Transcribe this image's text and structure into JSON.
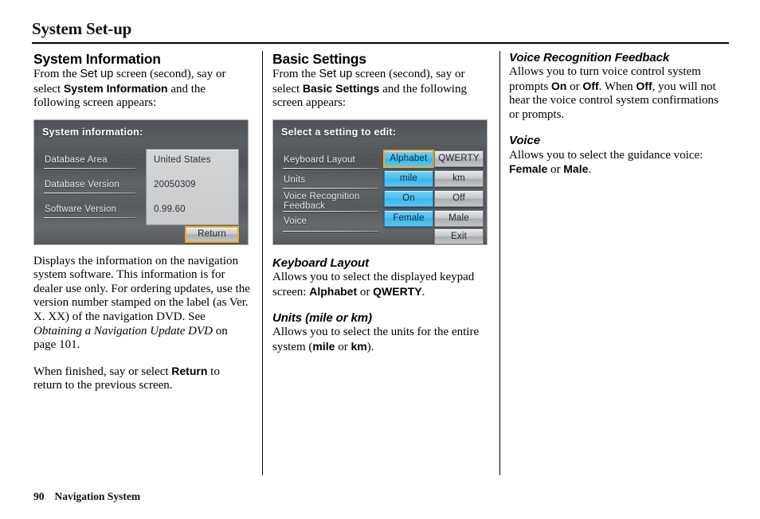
{
  "page": {
    "title": "System Set-up",
    "footer_page_number": "90",
    "footer_label": "Navigation System"
  },
  "columns": {
    "left": {
      "heading": "System Information",
      "intro_part1": "From the ",
      "intro_sans": "Set up",
      "intro_part2": " screen (second), say or select ",
      "intro_bold": "System Information",
      "intro_part3": " and the following screen appears:",
      "body_1_a": "Displays the information on the navigation system software. This information is for dealer use only. For ordering updates, use the version number stamped on the label (as Ver. X. XX) of the navigation DVD. See ",
      "body_1_italic": "Obtaining a Navigation Update DVD",
      "body_1_b": " on page 101.",
      "body_2_a": "When finished, say or select ",
      "body_2_bold": "Return",
      "body_2_b": " to return to the previous screen."
    },
    "middle": {
      "heading": "Basic Settings",
      "intro_part1": "From the ",
      "intro_sans": "Set up",
      "intro_part2": " screen (second), say or select ",
      "intro_bold": "Basic Settings",
      "intro_part3": " and the following screen appears:",
      "sub1_heading": "Keyboard Layout",
      "sub1_a": "Allows you to select the displayed keypad screen: ",
      "sub1_bold1": "Alphabet",
      "sub1_b": " or ",
      "sub1_bold2": "QWERTY",
      "sub1_c": ".",
      "sub2_heading": "Units (mile or km)",
      "sub2_a": "Allows you to select the units for the entire system (",
      "sub2_bold1": "mile",
      "sub2_b": " or ",
      "sub2_bold2": "km",
      "sub2_c": ")."
    },
    "right": {
      "sub1_heading": "Voice Recognition Feedback",
      "sub1_a": "Allows you to turn voice control system prompts ",
      "sub1_bold1": "On",
      "sub1_b": " or ",
      "sub1_bold2": "Off",
      "sub1_c": ". When ",
      "sub1_bold3": "Off",
      "sub1_d": ", you will not hear the voice control system confirmations or prompts.",
      "sub2_heading": "Voice",
      "sub2_a": "Allows you to select the guidance voice: ",
      "sub2_bold1": "Female",
      "sub2_b": " or ",
      "sub2_bold2": "Male",
      "sub2_c": "."
    }
  },
  "screenshot_system_information": {
    "title": "System information:",
    "rows": [
      {
        "label": "Database Area",
        "value": "United States"
      },
      {
        "label": "Database Version",
        "value": "20050309"
      },
      {
        "label": "Software Version",
        "value": "0.99.60"
      }
    ],
    "return_button": "Return",
    "selected_accent_color": "#f0a81c"
  },
  "screenshot_basic_settings": {
    "title": "Select a setting to edit:",
    "rows": [
      {
        "label": "Keyboard Layout",
        "option_a": "Alphabet",
        "option_b": "QWERTY",
        "selected": "Alphabet",
        "highlight": "outline"
      },
      {
        "label": "Units",
        "option_a": "mile",
        "option_b": "km",
        "selected": "mile",
        "highlight": "blue"
      },
      {
        "label": "Voice Recognition Feedback",
        "option_a": "On",
        "option_b": "Off",
        "selected": "On",
        "highlight": "blue"
      },
      {
        "label": "Voice",
        "option_a": "Female",
        "option_b": "Male",
        "selected": "Female",
        "highlight": "blue"
      }
    ],
    "exit_button": "Exit",
    "active_color": "#4fc0f0",
    "selected_accent_color": "#f0a81c"
  }
}
